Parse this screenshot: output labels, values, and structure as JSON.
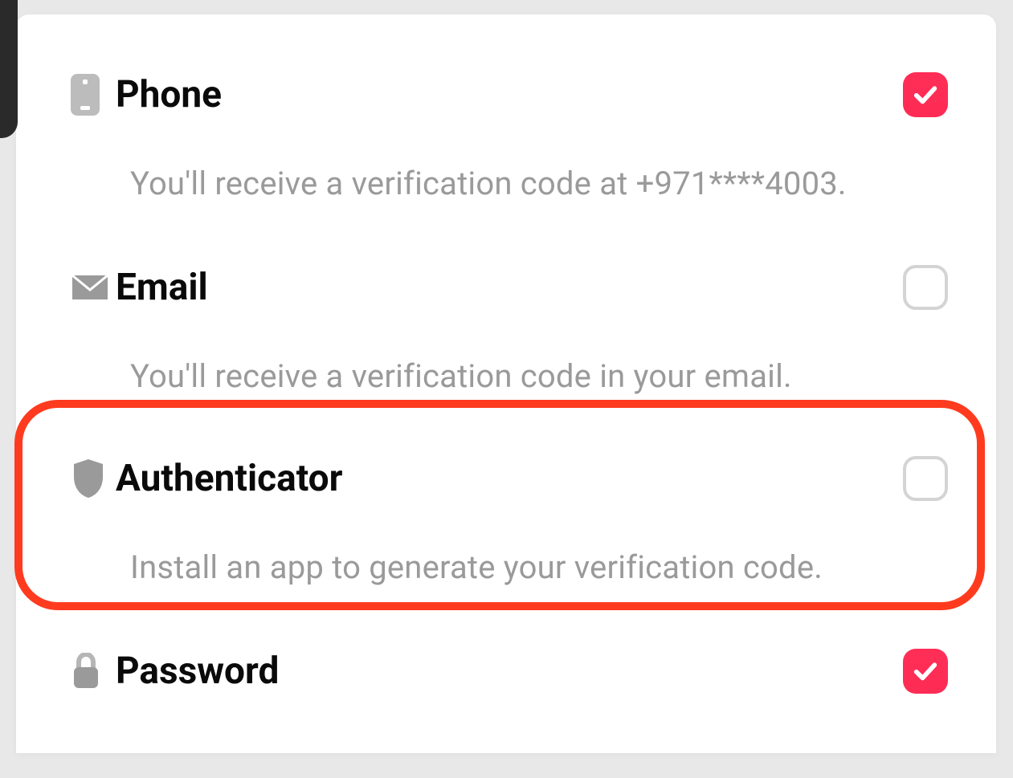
{
  "options": {
    "phone": {
      "title": "Phone",
      "description": "You'll receive a verification code at +971****4003.",
      "checked": true
    },
    "email": {
      "title": "Email",
      "description": "You'll receive a verification code in your email.",
      "checked": false
    },
    "authenticator": {
      "title": "Authenticator",
      "description": "Install an app to generate your verification code.",
      "checked": false,
      "highlighted": true
    },
    "password": {
      "title": "Password",
      "checked": true
    }
  },
  "colors": {
    "accent": "#fe2c55",
    "highlight": "#ff3b1f",
    "iconGray": "#bcbcbc",
    "textGray": "#9a9a9a"
  }
}
